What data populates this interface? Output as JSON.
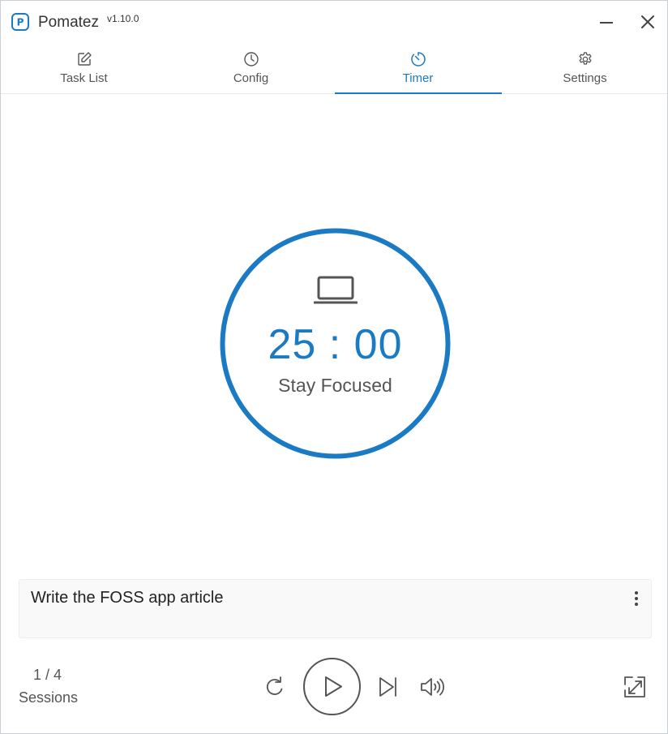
{
  "app": {
    "name": "Pomatez",
    "version": "v1.10.0",
    "logo_letter": "P"
  },
  "tabs": [
    {
      "label": "Task List",
      "icon": "edit-icon",
      "active": false
    },
    {
      "label": "Config",
      "icon": "clock-icon",
      "active": false
    },
    {
      "label": "Timer",
      "icon": "timer-icon",
      "active": true
    },
    {
      "label": "Settings",
      "icon": "gear-icon",
      "active": false
    }
  ],
  "timer": {
    "time": "25 : 00",
    "status": "Stay Focused",
    "mode_icon": "laptop-icon",
    "progress": 1.0
  },
  "task": {
    "text": "Write the FOSS app article"
  },
  "sessions": {
    "count": "1 / 4",
    "label": "Sessions"
  },
  "controls": [
    "reset-icon",
    "play-icon",
    "skip-icon",
    "volume-icon",
    "fullscreen-icon"
  ],
  "colors": {
    "accent": "#1a7ac4",
    "text": "#333333",
    "muted": "#555555"
  }
}
